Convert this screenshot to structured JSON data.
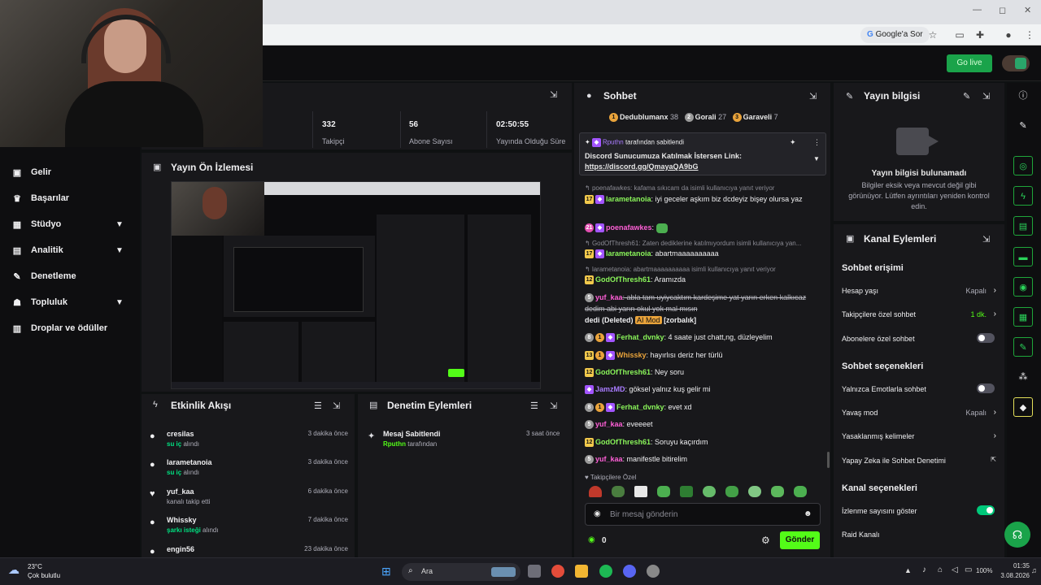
{
  "browser": {
    "win_min": "—",
    "win_max": "◻",
    "win_close": "✕",
    "google_chip": "Google'a Sor"
  },
  "header": {
    "go_live": "Go live"
  },
  "sidebar": {
    "items": [
      {
        "label": "Gelir",
        "icon": "dollar-icon",
        "glyph": "▣",
        "chevron": false
      },
      {
        "label": "Başarılar",
        "icon": "trophy-icon",
        "glyph": "♛",
        "chevron": false
      },
      {
        "label": "Stüdyo",
        "icon": "studio-icon",
        "glyph": "▦",
        "chevron": true
      },
      {
        "label": "Analitik",
        "icon": "analytics-icon",
        "glyph": "▤",
        "chevron": true
      },
      {
        "label": "Denetleme",
        "icon": "wrench-icon",
        "glyph": "✎",
        "chevron": false
      },
      {
        "label": "Topluluk",
        "icon": "community-icon",
        "glyph": "☗",
        "chevron": true
      },
      {
        "label": "Droplar ve ödüller",
        "icon": "gift-icon",
        "glyph": "▥",
        "chevron": false
      }
    ]
  },
  "stats": [
    {
      "value": "332",
      "label": "Takipçi"
    },
    {
      "value": "56",
      "label": "Abone Sayısı"
    },
    {
      "value": "02:50:55",
      "label": "Yayında Olduğu Süre"
    }
  ],
  "preview": {
    "title": "Yayın Ön İzlemesi"
  },
  "activity": {
    "title": "Etkinlik Akışı",
    "items": [
      {
        "name": "cresilas",
        "time": "3 dakika önce",
        "sub_bold": "su iç",
        "sub": " alındı",
        "icon": "reward-icon",
        "glyph": "●"
      },
      {
        "name": "larametanoia",
        "time": "3 dakika önce",
        "sub_bold": "su iç",
        "sub": " alındı",
        "icon": "reward-icon",
        "glyph": "●"
      },
      {
        "name": "yuf_kaa",
        "time": "6 dakika önce",
        "sub_bold": "",
        "sub": "kanalı takip etti",
        "icon": "heart-icon",
        "glyph": "♥"
      },
      {
        "name": "Whissky",
        "time": "7 dakika önce",
        "sub_bold": "şarkı isteği",
        "sub": " alındı",
        "icon": "reward-icon",
        "glyph": "●"
      },
      {
        "name": "engin56",
        "time": "23 dakika önce",
        "sub_bold": "",
        "sub": "",
        "icon": "reward-icon",
        "glyph": "●"
      }
    ]
  },
  "mod_actions": {
    "title": "Denetim Eylemleri",
    "item_title": "Mesaj Sabitlendi",
    "item_user": "Rputhn",
    "item_suffix": " tarafından",
    "item_time": "3 saat önce"
  },
  "chat": {
    "title": "Sohbet",
    "leaders": [
      {
        "rank": "1",
        "name": "Dedublumanx",
        "count": "38"
      },
      {
        "rank": "2",
        "name": "Gorali",
        "count": "27"
      },
      {
        "rank": "3",
        "name": "Garaveli",
        "count": "7"
      }
    ],
    "pinned_by_user": "Rputhn",
    "pinned_by_suffix": " tarafından sabitlendi",
    "pinned_text": "Discord Sunucumuza Katılmak İstersen Link:",
    "pinned_link": "https://discord.gg/QmayaQA9bG",
    "reply1": "poenafawkes: kafama sıkıcam da isimli kullanıcıya yanıt veriyor",
    "m1_user": "larametanoia",
    "m1_text": ": iyi geceler aşkım biz dcdeyiz bişey olursa yaz",
    "m2_user": "poenafawkes",
    "reply2": "GodOfThresh61: Zaten dediklerine katılmıyordum isimli kullanıcıya yan...",
    "m3_user": "larametanoia",
    "m3_text": ": abartmaaaaaaaaaa",
    "reply3": "larametanoia: abartmaaaaaaaaaa isimli kullanıcıya yanıt veriyor",
    "m4_user": "GodOfThresh61",
    "m4_text": ": Aramızda",
    "m5_user": "yuf_kaa",
    "m5_deleted": ": abla tam uyiycaktım kardeşime yat yarın erken kalkıcaz dedim abi yarın okul yok mal mısın",
    "m5_tag_deleted": "dedi (Deleted)",
    "m5_ai": "AI Mod",
    "m5_reason": "[zorbalık]",
    "m6_user": "Ferhat_dvnky",
    "m6_text": ": 4 saate just chatt,ng, düzleyelim",
    "m7_user": "Whissky",
    "m7_text": ": hayırlısı deriz her türlü",
    "m8_user": "GodOfThresh61",
    "m8_text": ": Ney soru",
    "m9_user": "JamzMD",
    "m9_text": ": göksel yalnız kuş gelir mi",
    "m10_user": "Ferhat_dvnky",
    "m10_text": ": evet xd",
    "m11_user": "yuf_kaa",
    "m11_text": ": eveeeet",
    "m12_user": "GodOfThresh61",
    "m12_text": ": Soruyu kaçırdım",
    "m13_user": "yuf_kaa",
    "m13_text": ": manifestle bitirelim",
    "emote_header": "Takipçilere Özel",
    "input_placeholder": "Bir mesaj gönderin",
    "points": "0",
    "send": "Gönder"
  },
  "stream_info": {
    "title": "Yayın bilgisi",
    "empty_title": "Yayın bilgisi bulunamadı",
    "empty_body": "Bilgiler eksik veya mevcut değil gibi görünüyor. Lütfen ayrıntıları yeniden kontrol edin."
  },
  "channel_actions": {
    "title": "Kanal Eylemleri",
    "sec1": "Sohbet erişimi",
    "r_account_age": "Hesap yaşı",
    "r_account_age_val": "Kapalı",
    "r_follower_chat": "Takipçilere özel sohbet",
    "r_follower_chat_val": "1 dk.",
    "r_sub_chat": "Abonelere özel sohbet",
    "sec2": "Sohbet seçenekleri",
    "r_emote_only": "Yalnızca Emotlarla sohbet",
    "r_slow": "Yavaş mod",
    "r_slow_val": "Kapalı",
    "r_banned_words": "Yasaklanmış kelimeler",
    "r_ai_mod": "Yapay Zeka ile Sohbet Denetimi",
    "sec3": "Kanal seçenekleri",
    "r_viewcount": "İzlenme sayısını göster",
    "r_raid": "Raid Kanalı"
  },
  "taskbar": {
    "weather_temp": "23°C",
    "weather_desc": "Çok bulutlu",
    "search": "Ara",
    "battery": "100%",
    "time": "01:35",
    "date": "3.08.2026"
  },
  "colors": {
    "accent_green": "#53fc18",
    "user_green": "#8af55a",
    "user_pink": "#ff5fd7",
    "user_purple": "#a97cff"
  }
}
